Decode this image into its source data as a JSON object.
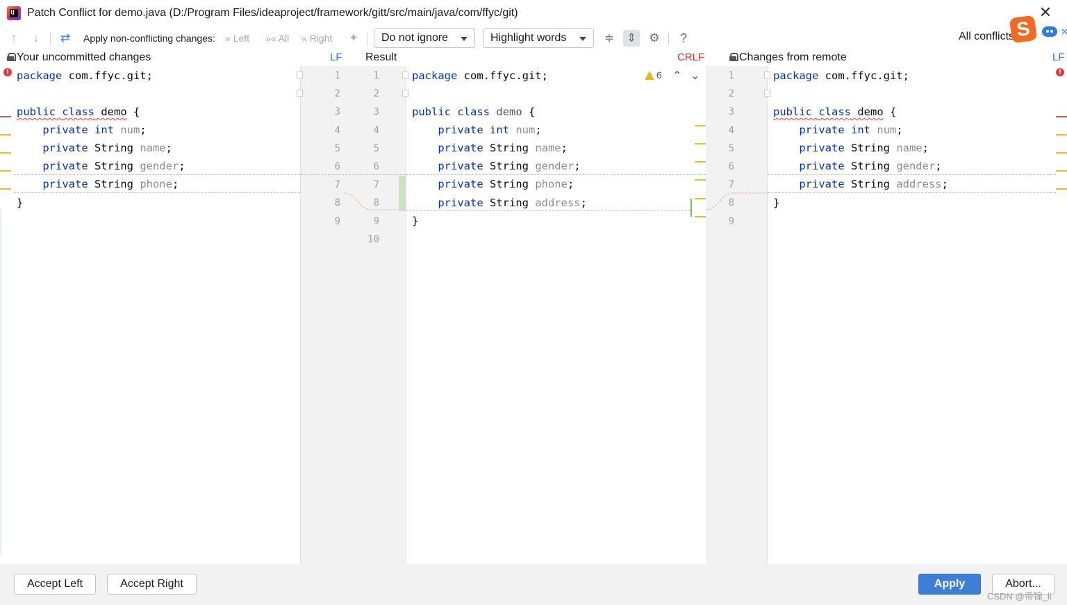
{
  "window": {
    "title": "Patch Conflict for demo.java (D:/Program Files/ideaproject/framework/gitt/src/main/java/com/ffyc/git)",
    "close_icon": "close-icon"
  },
  "toolbar": {
    "apply_label": "Apply non-conflicting changes:",
    "left": "Left",
    "all": "All",
    "right": "Right",
    "whitespace_select": "Do not ignore",
    "highlight_select": "Highlight words",
    "help": "?",
    "all_conflicts": "All conflicts"
  },
  "left_panel": {
    "title": "Your uncommitted changes",
    "line_separator": "LF",
    "lines": [
      "package com.ffyc.git;",
      "",
      "public class demo {",
      "    private int num;",
      "    private String name;",
      "    private String gender;",
      "    private String phone;",
      "}",
      ""
    ]
  },
  "center_panel": {
    "title": "Result",
    "line_separator": "CRLF",
    "warnings_count": "6",
    "left_line_numbers": [
      "1",
      "2",
      "3",
      "4",
      "5",
      "6",
      "7",
      "8",
      "9"
    ],
    "result_line_numbers": [
      "1",
      "2",
      "3",
      "4",
      "5",
      "6",
      "7",
      "8",
      "9",
      "10"
    ],
    "lines": [
      "package com.ffyc.git;",
      "",
      "public class demo {",
      "    private int num;",
      "    private String name;",
      "    private String gender;",
      "    private String phone;",
      "    private String address;",
      "}",
      ""
    ]
  },
  "right_panel": {
    "title": "Changes from remote",
    "line_separator": "LF",
    "line_numbers": [
      "1",
      "2",
      "3",
      "4",
      "5",
      "6",
      "7",
      "8",
      "9"
    ],
    "lines": [
      "package com.ffyc.git;",
      "",
      "public class demo {",
      "    private int num;",
      "    private String name;",
      "    private String gender;",
      "    private String address;",
      "}",
      ""
    ]
  },
  "footer": {
    "accept_left": "Accept Left",
    "accept_right": "Accept Right",
    "apply": "Apply",
    "abort": "Abort...",
    "watermark": "CSDN @帝锦_li"
  },
  "colors": {
    "keyword": "#0033b3",
    "conflict_marker": "#e8c021",
    "error_marker": "#d93f3f",
    "added_bar": "#c9e3c3",
    "primary_button": "#3d7fd6"
  }
}
